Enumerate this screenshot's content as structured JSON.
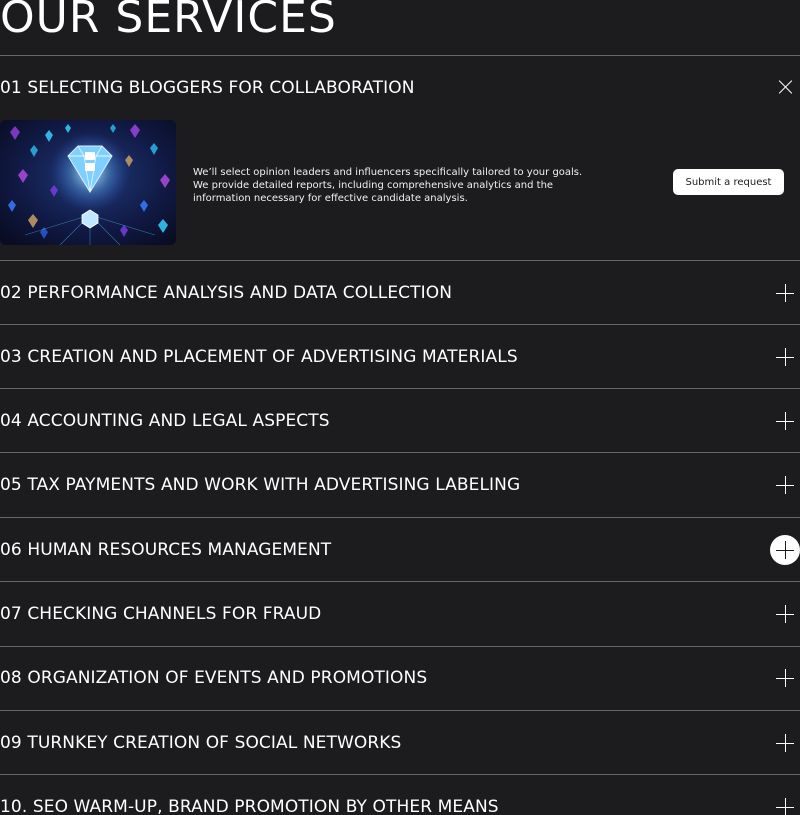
{
  "page": {
    "title": "OUR SERVICES"
  },
  "services": [
    {
      "title": "01 SELECTING BLOGGERS FOR COLLABORATION",
      "expanded": true,
      "description": [
        "We’ll select opinion leaders and influencers specifically tailored to your goals.",
        "We provide detailed reports, including comprehensive analytics and the",
        "information necessary for effective candidate analysis."
      ],
      "button_label": "Submit a request",
      "icon": "close-icon"
    },
    {
      "title": "02 PERFORMANCE ANALYSIS AND DATA COLLECTION",
      "icon": "plus-icon"
    },
    {
      "title": "03 CREATION AND PLACEMENT OF ADVERTISING MATERIALS",
      "icon": "plus-icon"
    },
    {
      "title": "04 ACCOUNTING AND LEGAL ASPECTS",
      "icon": "plus-icon"
    },
    {
      "title": "05 TAX PAYMENTS AND WORK WITH ADVERTISING LABELING",
      "icon": "plus-icon"
    },
    {
      "title": "06 HUMAN RESOURCES MANAGEMENT",
      "icon": "plus-icon",
      "hovered": true
    },
    {
      "title": "07 CHECKING CHANNELS FOR FRAUD",
      "icon": "plus-icon"
    },
    {
      "title": "08 ORGANIZATION OF EVENTS AND PROMOTIONS",
      "icon": "plus-icon"
    },
    {
      "title": "09 TURNKEY CREATION OF SOCIAL NETWORKS",
      "icon": "plus-icon"
    },
    {
      "title": "10. SEO WARM-UP, BRAND PROMOTION BY OTHER MEANS",
      "icon": "plus-icon"
    }
  ],
  "colors": {
    "background": "#1c1b1d",
    "text": "#ffffff",
    "divider": "#66656a",
    "button_bg": "#ffffff",
    "button_text": "#1c1b1d"
  }
}
